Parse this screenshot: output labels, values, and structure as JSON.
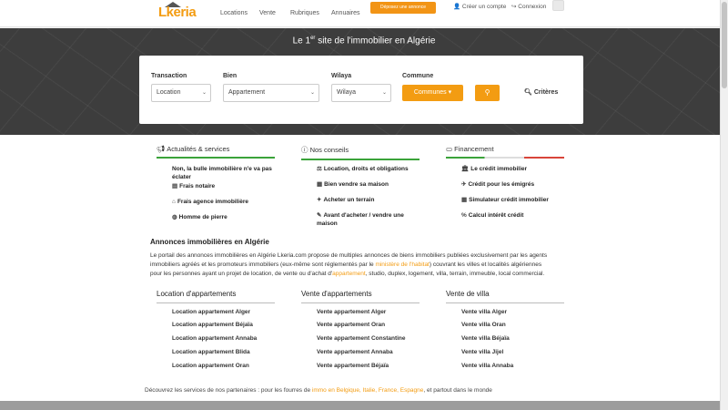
{
  "nav": {
    "logo_text": "Lkeria",
    "links": [
      "Locations",
      "Vente",
      "Rubriques",
      "Annuaires"
    ],
    "post_button": "Déposez une annonce",
    "create_account": "Créer un compte",
    "login": "Connexion"
  },
  "hero": {
    "title_pre": "Le 1",
    "title_sup": "er",
    "title_post": " site de l'immobilier en Algérie"
  },
  "search": {
    "transaction_label": "Transaction",
    "transaction_value": "Location",
    "bien_label": "Bien",
    "bien_value": "Appartement",
    "wilaya_label": "Wilaya",
    "wilaya_value": "Wilaya",
    "commune_label": "Commune",
    "communes_button": "Communes ▾",
    "criteres": "Critères"
  },
  "columns": [
    {
      "title": "Actualités & services",
      "links": [
        "Non, la bulle immobilière n'e va pas éclater",
        "Frais notaire",
        "Frais agence immobilière",
        "Homme de pierre"
      ]
    },
    {
      "title": "Nos conseils",
      "links": [
        "Location, droits et obligations",
        "Bien vendre sa maison",
        "Acheter un terrain",
        "Avant d'acheter / vendre une maison"
      ]
    },
    {
      "title": "Financement",
      "links": [
        "Le crédit immobilier",
        "Crédit pour les émigrés",
        "Simulateur crédit immobilier",
        "Calcul intérêt crédit"
      ]
    }
  ],
  "seo": {
    "title": "Annonces immobilières en Algérie",
    "p1": "Le portail des annonces immobilières en Algérie Lkeria.com propose de multiples annonces de biens immobiliers publiées exclusivement par les agents",
    "p2a": "immobiliers agréés et les promoteurs immobiliers (eux-même sont réglementés par le ",
    "p2_link": "ministère de l'habitat",
    "p2b": ") couvrant les villes et localités algériennes",
    "p3a": "pour les personnes ayant un projet de location, de vente ou d'achat d'",
    "p3_link": "appartement",
    "p3b": ", studio, duplex, logement, villa, terrain, immeuble, local commercial."
  },
  "lists": [
    {
      "title": "Location d'appartements",
      "items": [
        "Location appartement Alger",
        "Location appartement Béjaïa",
        "Location appartement Annaba",
        "Location appartement Blida",
        "Location appartement Oran"
      ]
    },
    {
      "title": "Vente d'appartements",
      "items": [
        "Vente appartement Alger",
        "Vente appartement Oran",
        "Vente appartement Constantine",
        "Vente appartement Annaba",
        "Vente appartement Béjaïa"
      ]
    },
    {
      "title": "Vente de villa",
      "items": [
        "Vente villa Alger",
        "Vente villa Oran",
        "Vente villa Béjaïa",
        "Vente villa Jijel",
        "Vente villa Annaba"
      ]
    }
  ],
  "partners": {
    "text_a": "Découvrez les services de nos partenaires : pour les fourres de ",
    "link": "immo en Belgique, Italie, France, Espagne",
    "text_b": ", et partout dans le monde"
  },
  "colors": {
    "accent": "#f39c12",
    "hero_bg": "#3d3d3d",
    "green": "#3ba33a",
    "red": "#d9453a"
  }
}
